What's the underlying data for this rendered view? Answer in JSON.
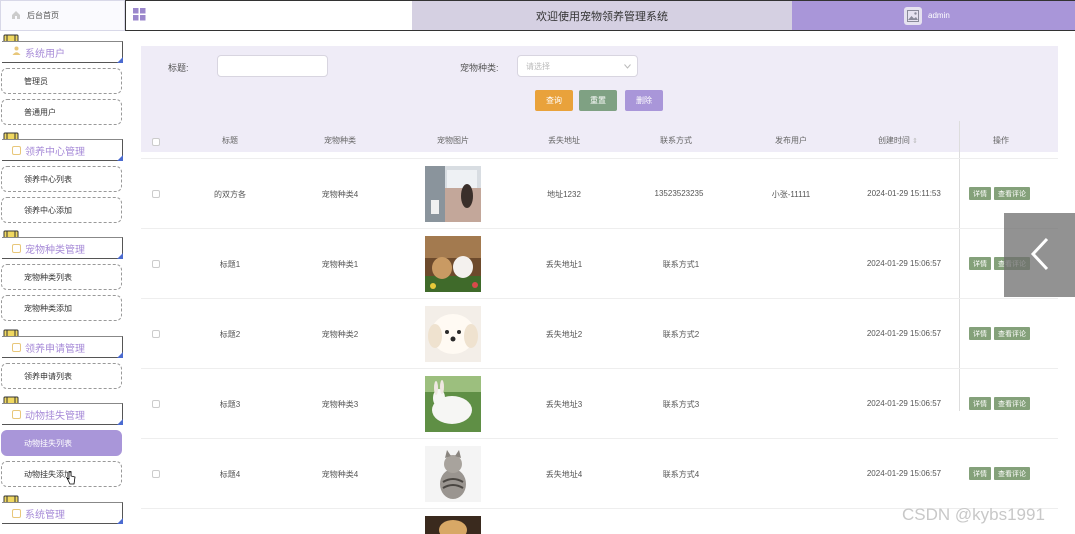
{
  "header": {
    "home_label": "后台首页",
    "title": "欢迎使用宠物领养管理系统",
    "username": "admin"
  },
  "sidebar": {
    "groups": [
      {
        "label": "系统用户",
        "items": [
          "管理员",
          "普通用户"
        ]
      },
      {
        "label": "领养中心管理",
        "items": [
          "领养中心列表",
          "领养中心添加"
        ]
      },
      {
        "label": "宠物种类管理",
        "items": [
          "宠物种类列表",
          "宠物种类添加"
        ]
      },
      {
        "label": "领养申请管理",
        "items": [
          "领养申请列表"
        ]
      },
      {
        "label": "动物挂失管理",
        "items": [
          "动物挂失列表",
          "动物挂失添加"
        ]
      },
      {
        "label": "系统管理",
        "items": []
      }
    ],
    "active_item": "动物挂失列表"
  },
  "filter": {
    "title_label": "标题:",
    "title_value": "",
    "type_label": "宠物种类:",
    "type_placeholder": "请选择",
    "search_label": "查询",
    "reset_label": "重置",
    "delete_label": "删除"
  },
  "table": {
    "columns": [
      "标题",
      "宠物种类",
      "宠物图片",
      "丢失地址",
      "联系方式",
      "发布用户",
      "创建时间",
      "操作"
    ],
    "rows": [
      {
        "title": "的双方各",
        "type": "宠物种类4",
        "address": "地址1232",
        "contact": "13523523235",
        "user": "小张-11111",
        "created": "2024-01-29 15:11:53",
        "photo": "photo-dog-window"
      },
      {
        "title": "标题1",
        "type": "宠物种类1",
        "address": "丢失地址1",
        "contact": "联系方式1",
        "user": "",
        "created": "2024-01-29 15:06:57",
        "photo": "photo-rabbits"
      },
      {
        "title": "标题2",
        "type": "宠物种类2",
        "address": "丢失地址2",
        "contact": "联系方式2",
        "user": "",
        "created": "2024-01-29 15:06:57",
        "photo": "photo-white-puppy"
      },
      {
        "title": "标题3",
        "type": "宠物种类3",
        "address": "丢失地址3",
        "contact": "联系方式3",
        "user": "",
        "created": "2024-01-29 15:06:57",
        "photo": "photo-white-rabbit"
      },
      {
        "title": "标题4",
        "type": "宠物种类4",
        "address": "丢失地址4",
        "contact": "联系方式4",
        "user": "",
        "created": "2024-01-29 15:06:57",
        "photo": "photo-tabby-cat"
      }
    ],
    "detail_label": "详情",
    "comment_label": "查看评论"
  },
  "watermark": "CSDN @kybs1991",
  "colors": {
    "accent": "#a996d9",
    "search": "#e9a23b",
    "reset": "#7fa183",
    "delete": "#a996d9",
    "op": "#84a17a"
  }
}
